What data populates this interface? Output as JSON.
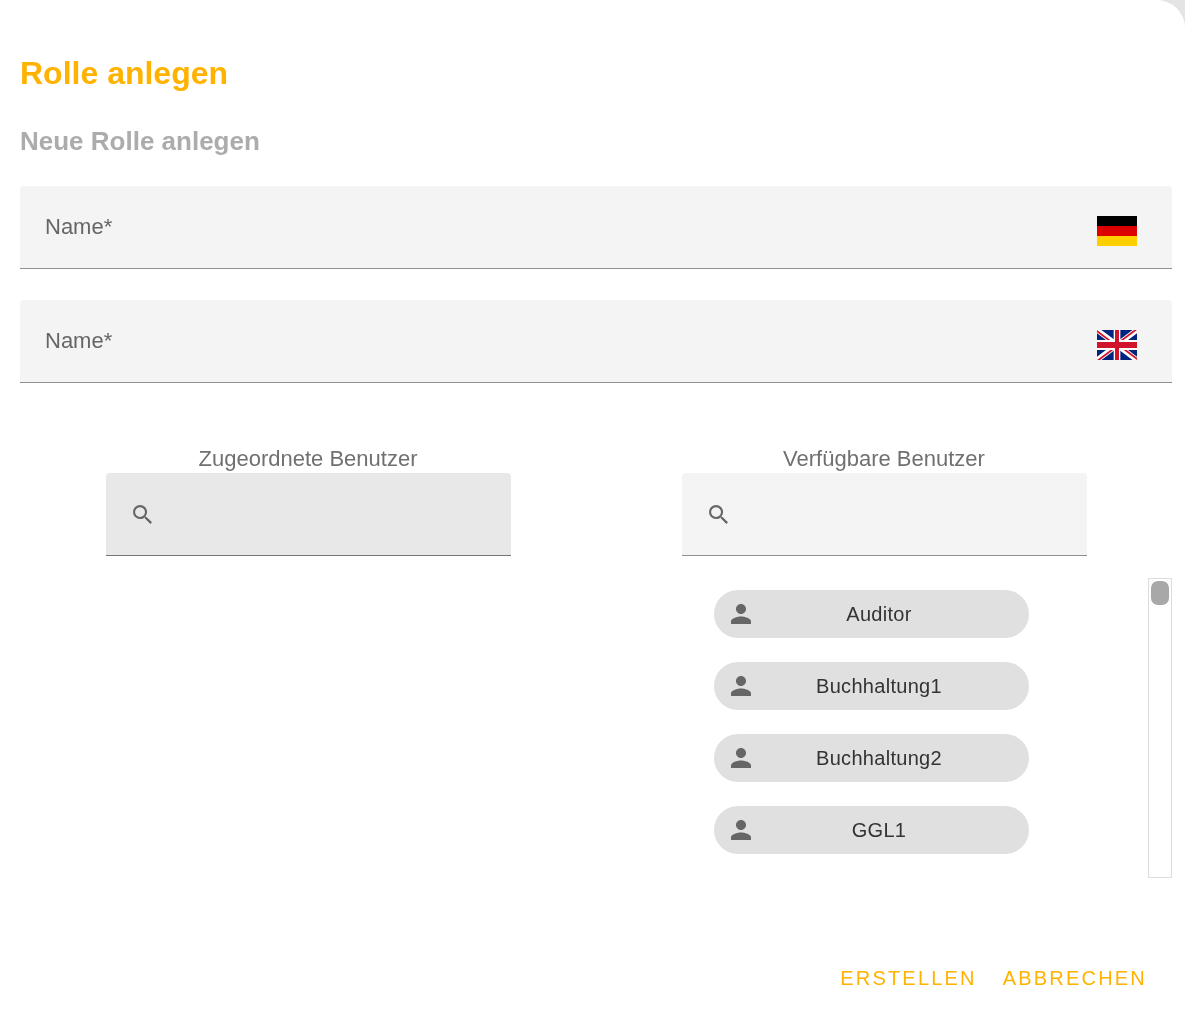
{
  "dialog": {
    "title": "Rolle anlegen",
    "subtitle": "Neue Rolle anlegen"
  },
  "name_fields": [
    {
      "placeholder": "Name*",
      "kind": "german"
    },
    {
      "placeholder": "Name*",
      "kind": "british"
    }
  ],
  "assigned_users": {
    "title": "Zugeordnete Benutzer",
    "search": {
      "hovered": true
    }
  },
  "available_users": {
    "title": "Verfügbare Benutzer",
    "search": {
      "hovered": false
    },
    "users": [
      {
        "name": "Auditor"
      },
      {
        "name": "Buchhaltung1"
      },
      {
        "name": "Buchhaltung2"
      },
      {
        "name": "GGL1"
      }
    ]
  },
  "actions": [
    {
      "label": "ERSTELLEN"
    },
    {
      "label": "ABBRECHEN"
    }
  ]
}
